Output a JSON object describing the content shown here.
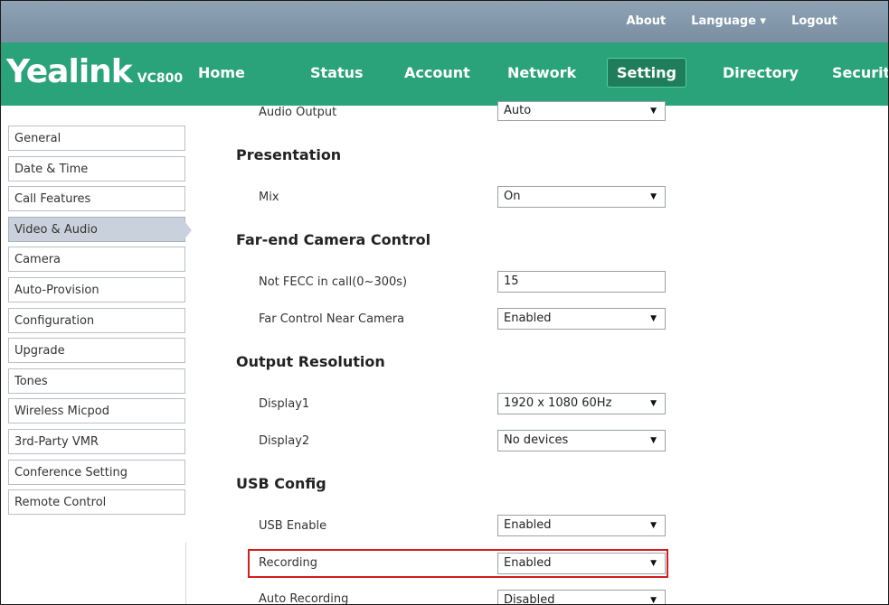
{
  "topbar": {
    "about": "About",
    "language": "Language ▾",
    "logout": "Logout"
  },
  "logo": {
    "brand": "Yealink",
    "model": "VC800"
  },
  "nav": [
    "Home",
    "Status",
    "Account",
    "Network",
    "Setting",
    "Directory",
    "Security"
  ],
  "nav_active": "Setting",
  "sidebar": [
    "General",
    "Date & Time",
    "Call Features",
    "Video & Audio",
    "Camera",
    "Auto-Provision",
    "Configuration",
    "Upgrade",
    "Tones",
    "Wireless Micpod",
    "3rd-Party VMR",
    "Conference Setting",
    "Remote Control"
  ],
  "sidebar_active": "Video & Audio",
  "content": {
    "audio_output_label": "Audio Output",
    "audio_output_value": "Auto",
    "presentation_title": "Presentation",
    "mix_label": "Mix",
    "mix_value": "On",
    "fecc_title": "Far-end Camera Control",
    "not_fecc_label": "Not FECC in call(0~300s)",
    "not_fecc_value": "15",
    "far_control_label": "Far Control Near Camera",
    "far_control_value": "Enabled",
    "output_title": "Output Resolution",
    "display1_label": "Display1",
    "display1_value": "1920 x 1080 60Hz",
    "display2_label": "Display2",
    "display2_value": "No devices",
    "usb_title": "USB Config",
    "usb_enable_label": "USB Enable",
    "usb_enable_value": "Enabled",
    "recording_label": "Recording",
    "recording_value": "Enabled",
    "auto_recording_label": "Auto Recording",
    "auto_recording_value": "Disabled"
  },
  "colors": {
    "nav_bg": "#2aa37a",
    "topbar_bg": "#8296aa",
    "highlight": "#d11f1f"
  }
}
